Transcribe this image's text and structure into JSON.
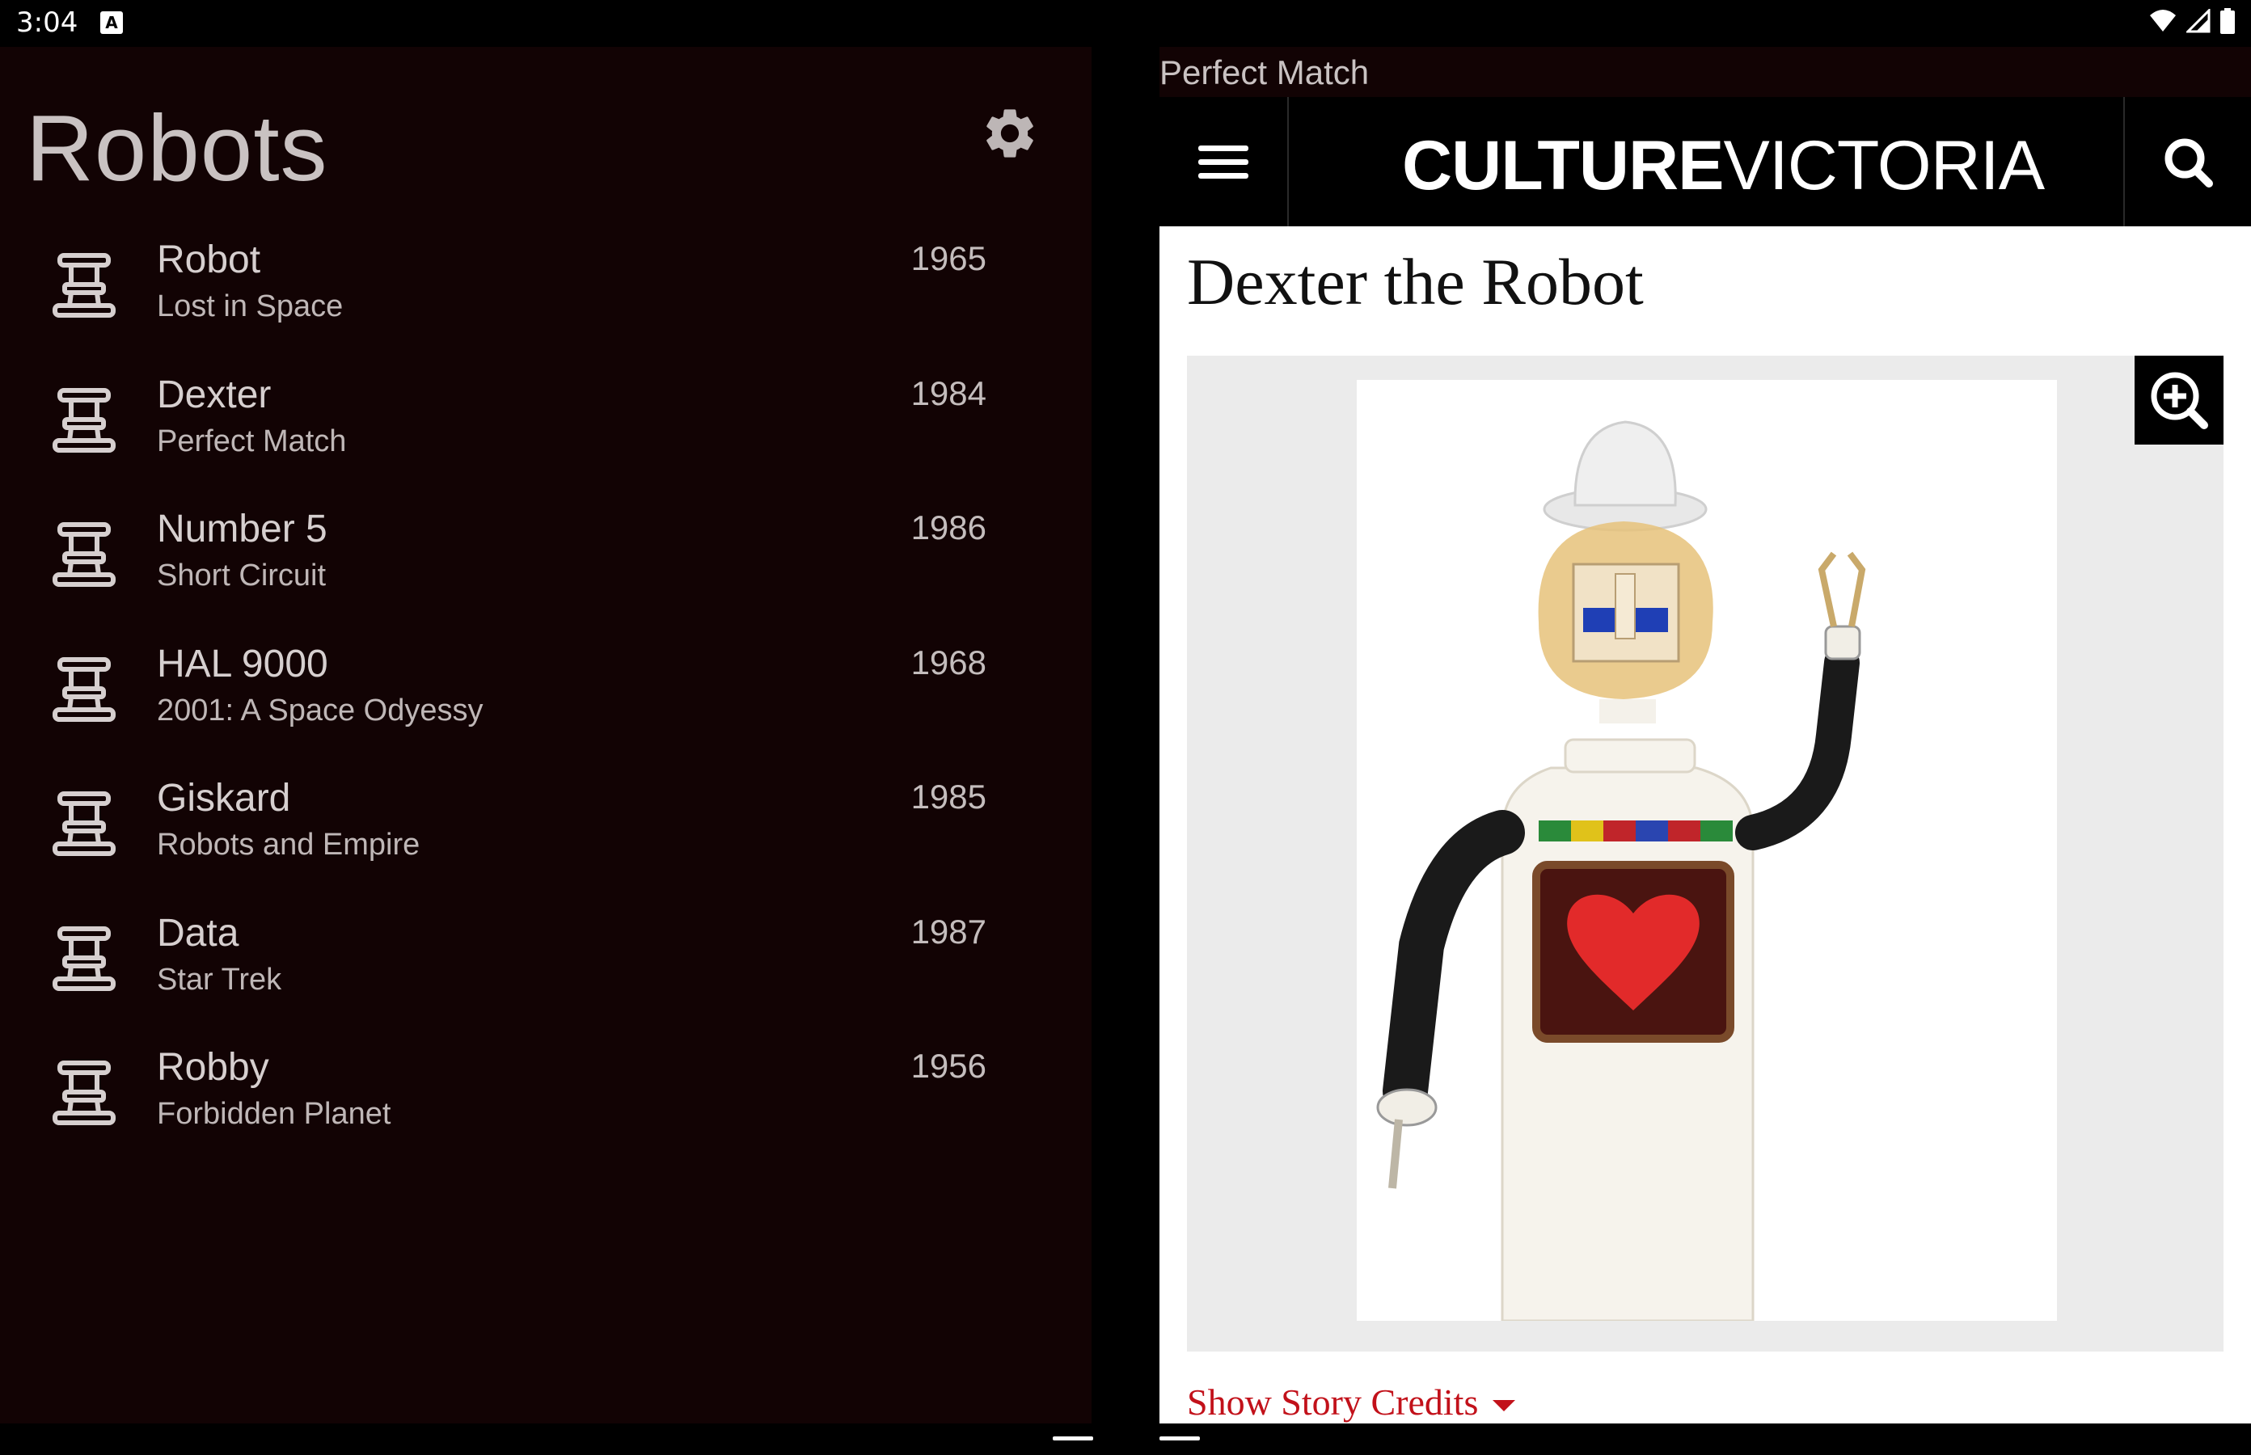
{
  "status_bar": {
    "time": "3:04",
    "notification_badge": "A",
    "icons": [
      "wifi-icon",
      "signal-icon",
      "battery-icon"
    ]
  },
  "app": {
    "title": "Robots",
    "settings_icon": "gear-icon",
    "robots": [
      {
        "name": "Robot",
        "source": "Lost in Space",
        "year": "1965"
      },
      {
        "name": "Dexter",
        "source": "Perfect Match",
        "year": "1984"
      },
      {
        "name": "Number 5",
        "source": "Short Circuit",
        "year": "1986"
      },
      {
        "name": "HAL 9000",
        "source": "2001: A Space Odyessy",
        "year": "1968"
      },
      {
        "name": "Giskard",
        "source": "Robots and Empire",
        "year": "1985"
      },
      {
        "name": "Data",
        "source": "Star Trek",
        "year": "1987"
      },
      {
        "name": "Robby",
        "source": "Forbidden Planet",
        "year": "1956"
      }
    ]
  },
  "web": {
    "window_title": "Perfect Match",
    "logo_bold": "CULTURE",
    "logo_light": "VICTORIA",
    "article_title": "Dexter the Robot",
    "show_credits": "Show Story Credits",
    "icons": [
      "hamburger-menu-icon",
      "search-icon",
      "zoom-in-icon",
      "caret-down-icon"
    ]
  },
  "colors": {
    "pane_bg": "#120304",
    "text": "#d6cfcf",
    "link_red": "#c2111a"
  }
}
